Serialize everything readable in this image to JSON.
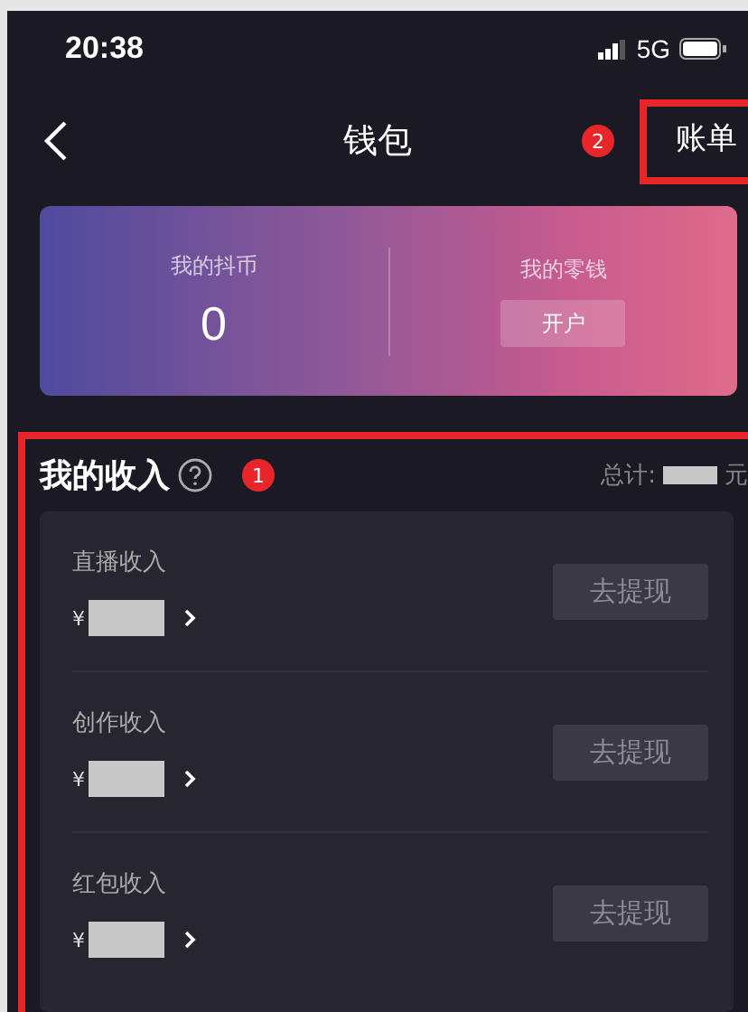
{
  "status_bar": {
    "time": "20:38",
    "network": "5G"
  },
  "header": {
    "title": "钱包",
    "bills": {
      "label": "账单",
      "highlighted": true,
      "badge": "2"
    }
  },
  "balance_card": {
    "coins": {
      "label": "我的抖币",
      "value": "0"
    },
    "change": {
      "label": "我的零钱",
      "button": "开户"
    }
  },
  "income": {
    "title": "我的收入",
    "highlighted": true,
    "badge": "1",
    "total_label": "总计:",
    "total_unit": "元",
    "rows": [
      {
        "label": "直播收入",
        "currency": "¥",
        "button": "去提现"
      },
      {
        "label": "创作收入",
        "currency": "¥",
        "button": "去提现"
      },
      {
        "label": "红包收入",
        "currency": "¥",
        "button": "去提现"
      }
    ]
  }
}
